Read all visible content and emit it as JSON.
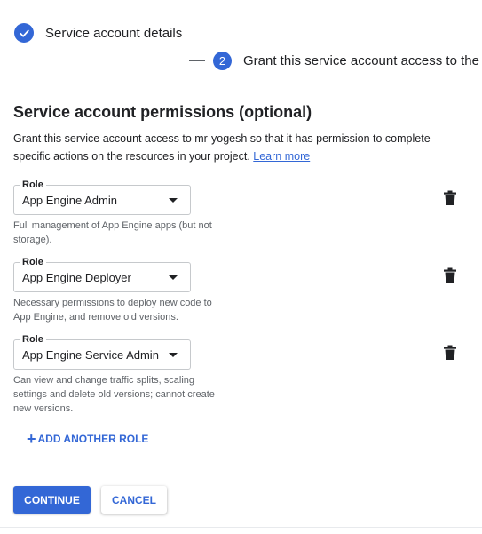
{
  "stepper": {
    "step1": {
      "label": "Service account details",
      "icon": "check-icon"
    },
    "step2": {
      "number": "2",
      "label": "Grant this service account access to the"
    }
  },
  "section": {
    "title": "Service account permissions (optional)",
    "description": "Grant this service account access to mr-yogesh so that it has permission to complete specific actions on the resources in your project.",
    "learn_more": "Learn more"
  },
  "roles": [
    {
      "field_label": "Role",
      "value": "App Engine Admin",
      "help": "Full management of App Engine apps (but not storage)."
    },
    {
      "field_label": "Role",
      "value": "App Engine Deployer",
      "help": "Necessary permissions to deploy new code to App Engine, and remove old versions."
    },
    {
      "field_label": "Role",
      "value": "App Engine Service Admin",
      "help": "Can view and change traffic splits, scaling settings and delete old versions; cannot create new versions."
    }
  ],
  "add_role": {
    "label": "ADD ANOTHER ROLE",
    "icon": "plus-icon"
  },
  "buttons": {
    "continue": "CONTINUE",
    "cancel": "CANCEL"
  },
  "colors": {
    "accent": "#3367d6",
    "text": "#202124",
    "muted": "#5f6368"
  }
}
